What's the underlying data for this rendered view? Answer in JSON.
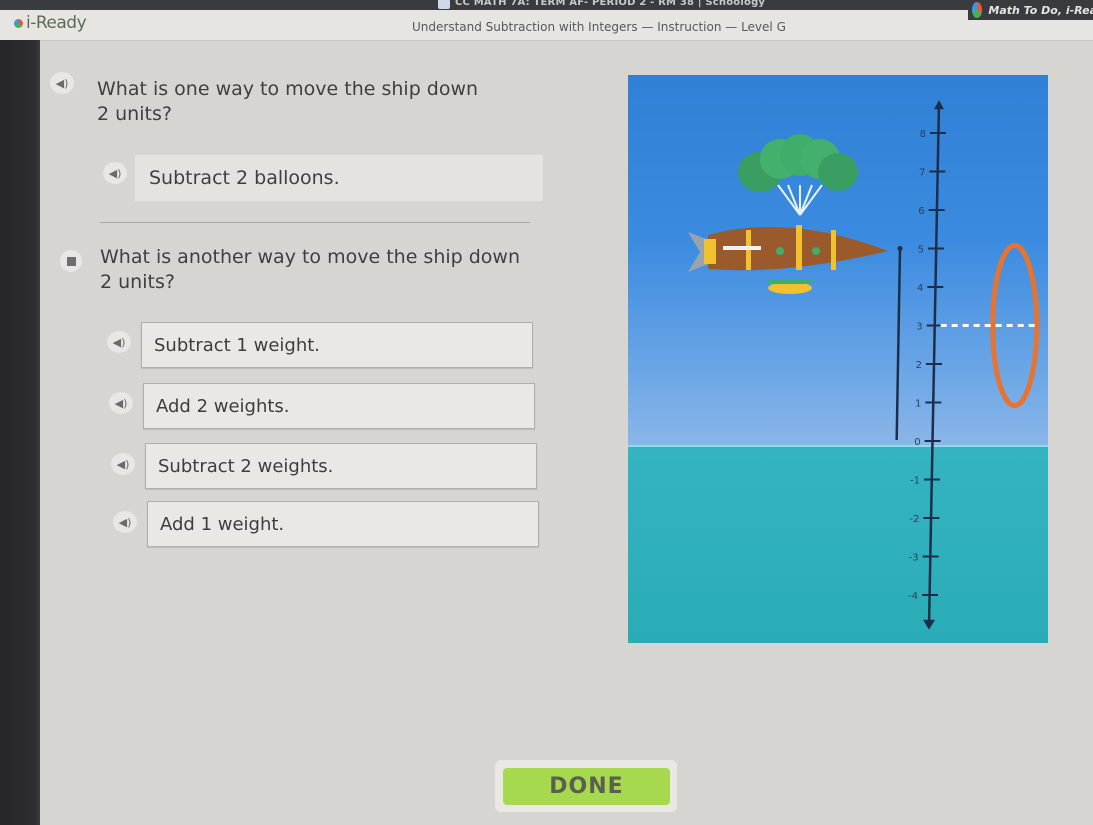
{
  "browser": {
    "tab_title": "CC MATH 7A: TERM AF- PERIOD 2 - RM 38 | Schoology",
    "extension_label": "Math To Do, i-Rea"
  },
  "header": {
    "logo_text": "i-Ready",
    "lesson_title": "Understand Subtraction with Integers — Instruction — Level G"
  },
  "question1": {
    "text_line1": "What is one way to move the ship down",
    "text_line2": "2 units?",
    "answer": "Subtract 2 balloons."
  },
  "question2": {
    "text_line1": "What is another way to move the ship down",
    "text_line2": "2 units?",
    "options": [
      {
        "label": "Subtract 1 weight."
      },
      {
        "label": "Add 2 weights."
      },
      {
        "label": "Subtract 2 weights."
      },
      {
        "label": "Add 1 weight."
      }
    ]
  },
  "scene": {
    "number_line": {
      "min": -4,
      "max": 8,
      "ticks": [
        "8",
        "7",
        "6",
        "5",
        "4",
        "3",
        "2",
        "1",
        "0",
        "-1",
        "-2",
        "-3",
        "-4"
      ],
      "ship_level": 5,
      "target_ring_level": 3
    },
    "colors": {
      "sky": "#3b8be0",
      "water": "#2aacb7",
      "ring": "#e8732e",
      "balloons": "#3fae6a"
    }
  },
  "footer": {
    "done_label": "DONE",
    "done_color": "#a7d94f"
  }
}
